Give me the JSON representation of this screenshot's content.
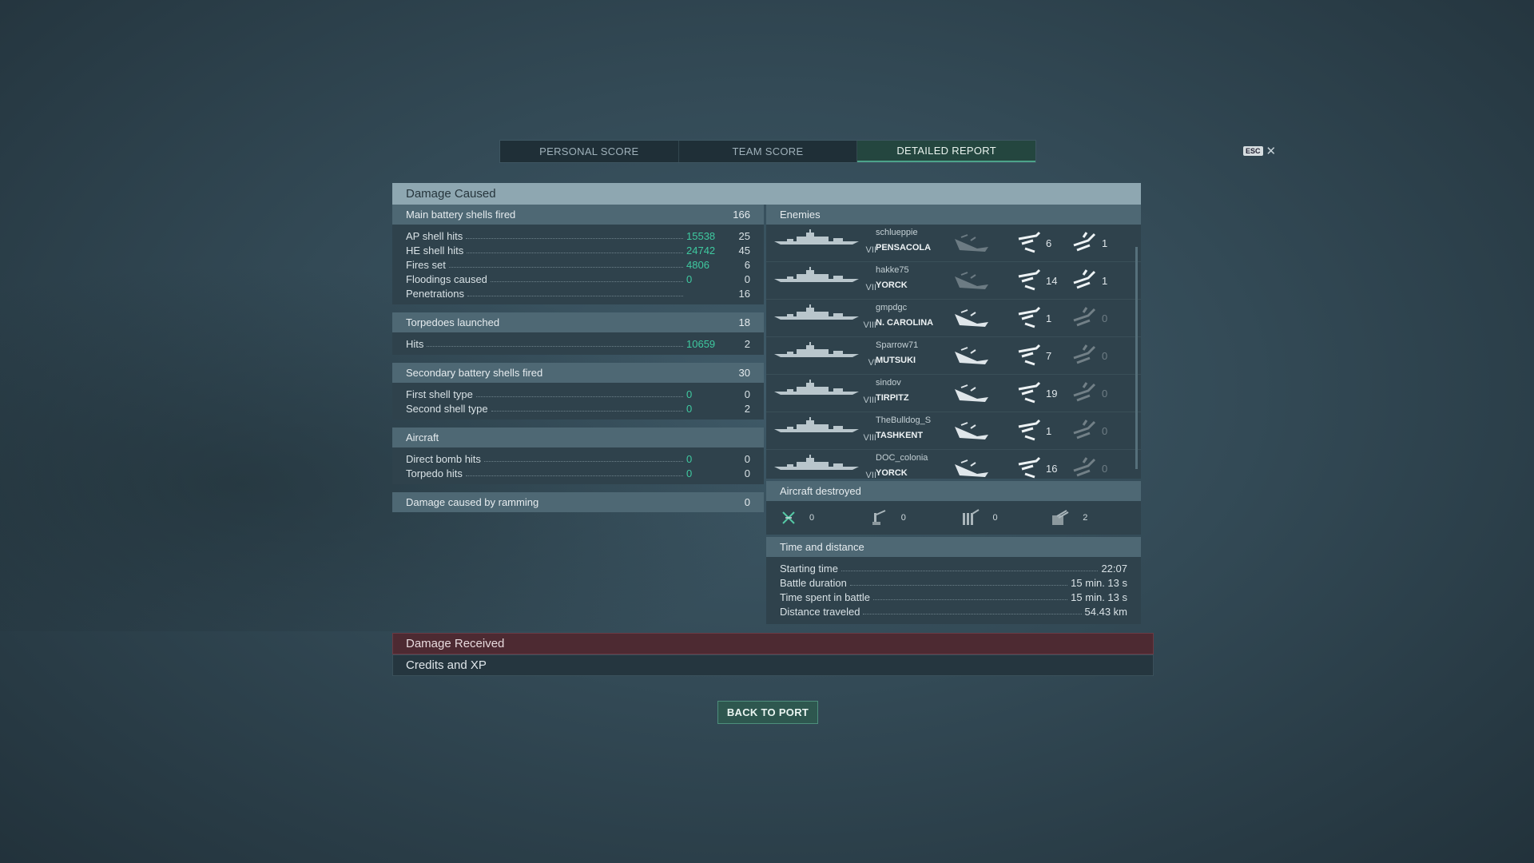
{
  "tabs": [
    {
      "label": "PERSONAL SCORE",
      "active": false
    },
    {
      "label": "TEAM SCORE",
      "active": false
    },
    {
      "label": "DETAILED REPORT",
      "active": true
    }
  ],
  "esc": {
    "key": "ESC",
    "close": "✕"
  },
  "damage_caused": {
    "title": "Damage Caused",
    "main_battery": {
      "label": "Main battery shells fired",
      "value": "166",
      "rows": [
        {
          "label": "AP shell hits",
          "damage": "15538",
          "count": "25"
        },
        {
          "label": "HE shell hits",
          "damage": "24742",
          "count": "45"
        },
        {
          "label": "Fires set",
          "damage": "4806",
          "count": "6"
        },
        {
          "label": "Floodings caused",
          "damage": "0",
          "count": "0"
        },
        {
          "label": "Penetrations",
          "damage": "",
          "count": "16"
        }
      ]
    },
    "torpedoes": {
      "label": "Torpedoes launched",
      "value": "18",
      "rows": [
        {
          "label": "Hits",
          "damage": "10659",
          "count": "2"
        }
      ]
    },
    "secondary": {
      "label": "Secondary battery shells fired",
      "value": "30",
      "rows": [
        {
          "label": "First shell type",
          "damage": "0",
          "count": "0"
        },
        {
          "label": "Second shell type",
          "damage": "0",
          "count": "2"
        }
      ]
    },
    "aircraft": {
      "label": "Aircraft",
      "rows": [
        {
          "label": "Direct bomb hits",
          "damage": "0",
          "count": "0"
        },
        {
          "label": "Torpedo hits",
          "damage": "0",
          "count": "0"
        }
      ]
    },
    "ramming": {
      "label": "Damage caused by ramming",
      "value": "0"
    }
  },
  "enemies": {
    "title": "Enemies",
    "list": [
      {
        "player": "schlueppie",
        "ship": "PENSACOLA",
        "tier": "VII",
        "hits": "6",
        "crit": "1",
        "ic1_dim": true,
        "ic2_dim": false,
        "ic3_dim": false
      },
      {
        "player": "hakke75",
        "ship": "YORCK",
        "tier": "VII",
        "hits": "14",
        "crit": "1",
        "ic1_dim": true,
        "ic2_dim": false,
        "ic3_dim": false
      },
      {
        "player": "gmpdgc",
        "ship": "N. CAROLINA",
        "tier": "VIII",
        "hits": "1",
        "crit": "0",
        "ic1_dim": false,
        "ic2_dim": false,
        "ic3_dim": true
      },
      {
        "player": "Sparrow71",
        "ship": "MUTSUKI",
        "tier": "VI",
        "hits": "7",
        "crit": "0",
        "ic1_dim": false,
        "ic2_dim": false,
        "ic3_dim": true
      },
      {
        "player": "sindov",
        "ship": "TIRPITZ",
        "tier": "VIII",
        "hits": "19",
        "crit": "0",
        "ic1_dim": false,
        "ic2_dim": false,
        "ic3_dim": true
      },
      {
        "player": "TheBulldog_S",
        "ship": "TASHKENT",
        "tier": "VIII",
        "hits": "1",
        "crit": "0",
        "ic1_dim": false,
        "ic2_dim": false,
        "ic3_dim": true
      },
      {
        "player": "DOC_colonia",
        "ship": "YORCK",
        "tier": "VII",
        "hits": "16",
        "crit": "0",
        "ic1_dim": false,
        "ic2_dim": false,
        "ic3_dim": true
      }
    ]
  },
  "aircraft_destroyed": {
    "title": "Aircraft destroyed",
    "items": [
      {
        "icon": "fighter-destroyed-icon",
        "value": "0"
      },
      {
        "icon": "aa-single-gun-icon",
        "value": "0"
      },
      {
        "icon": "aa-multi-gun-icon",
        "value": "0"
      },
      {
        "icon": "aa-battery-icon",
        "value": "2"
      }
    ]
  },
  "time_distance": {
    "title": "Time and distance",
    "rows": [
      {
        "label": "Starting time",
        "value": "22:07"
      },
      {
        "label": "Battle duration",
        "value": "15 min. 13 s"
      },
      {
        "label": "Time spent in battle",
        "value": "15 min. 13 s"
      },
      {
        "label": "Distance traveled",
        "value": "54.43 km"
      }
    ]
  },
  "damage_received_label": "Damage Received",
  "credits_label": "Credits and XP",
  "back_label": "BACK TO PORT",
  "colors": {
    "accent": "#3fc9a0",
    "header": "#8ea7b1",
    "red_bar": "#4d2a32"
  }
}
